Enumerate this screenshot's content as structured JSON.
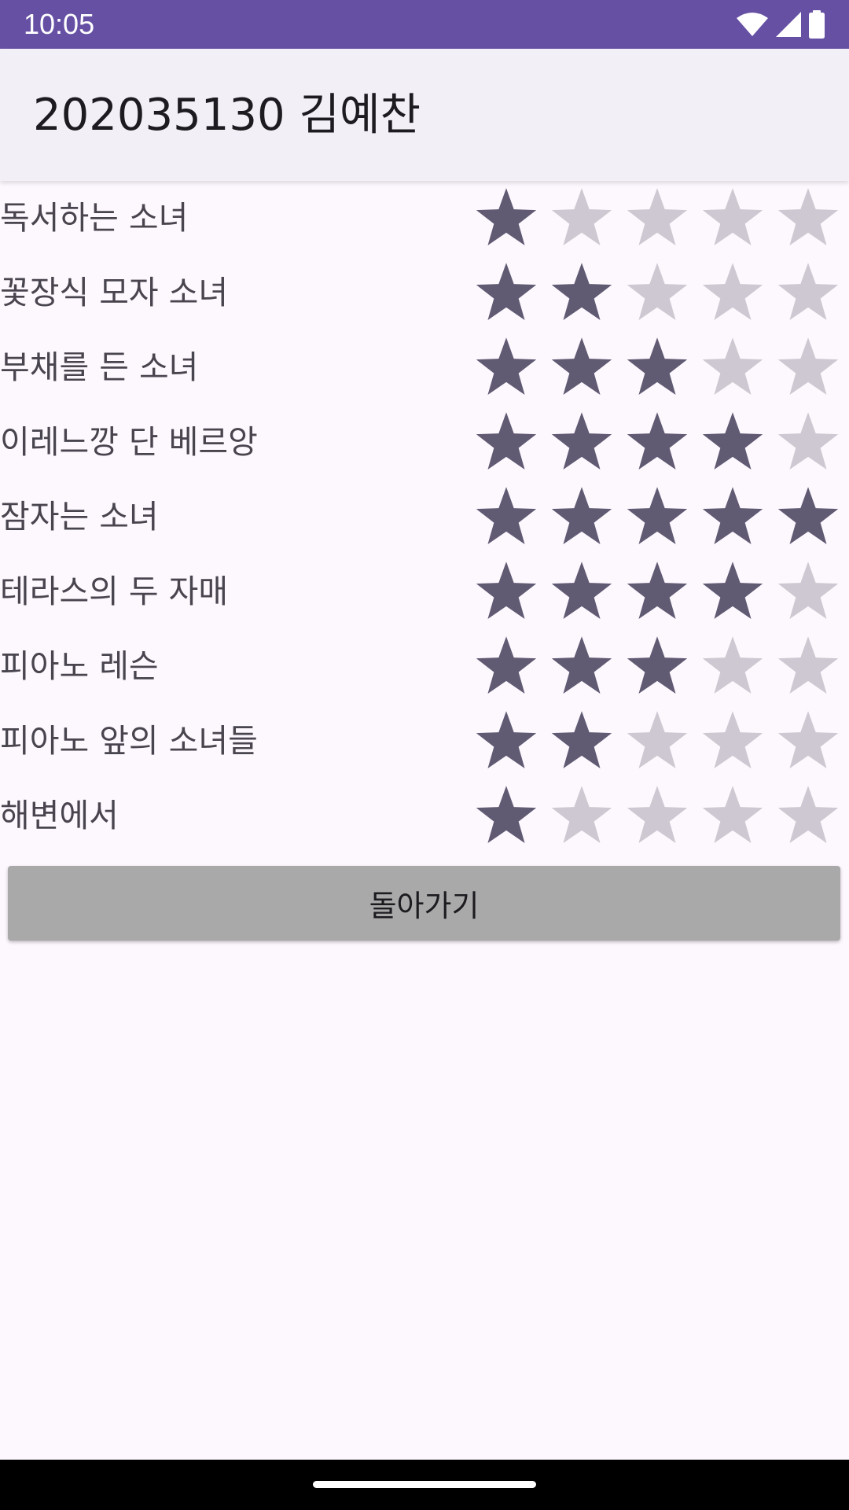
{
  "status_bar": {
    "time": "10:05",
    "icons": [
      "wifi-icon",
      "signal-icon",
      "battery-icon"
    ],
    "color": "#6650a4"
  },
  "app_bar": {
    "title": "202035130 김예찬"
  },
  "colors": {
    "star_filled": "#605a73",
    "star_empty": "#cdc8d1"
  },
  "ratings": [
    {
      "title": "독서하는 소녀",
      "rating": 1,
      "max": 5
    },
    {
      "title": "꽃장식 모자 소녀",
      "rating": 2,
      "max": 5
    },
    {
      "title": "부채를 든 소녀",
      "rating": 3,
      "max": 5
    },
    {
      "title": "이레느깡 단 베르앙",
      "rating": 4,
      "max": 5
    },
    {
      "title": "잠자는 소녀",
      "rating": 5,
      "max": 5
    },
    {
      "title": "테라스의 두 자매",
      "rating": 4,
      "max": 5
    },
    {
      "title": "피아노 레슨",
      "rating": 3,
      "max": 5
    },
    {
      "title": "피아노 앞의 소녀들",
      "rating": 2,
      "max": 5
    },
    {
      "title": "해변에서",
      "rating": 1,
      "max": 5
    }
  ],
  "back_button": {
    "label": "돌아가기"
  }
}
